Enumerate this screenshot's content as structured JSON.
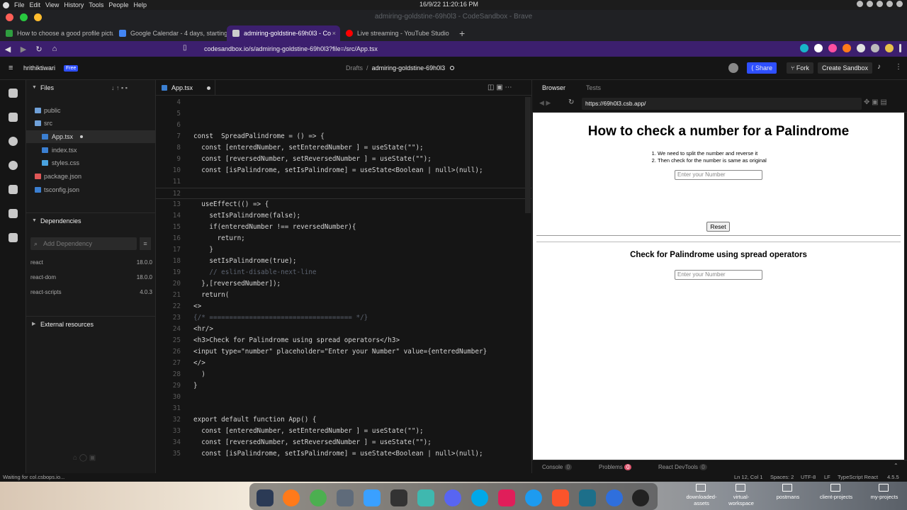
{
  "os": {
    "menu": [
      "File",
      "Edit",
      "View",
      "History",
      "Tools",
      "People",
      "Help"
    ],
    "clock": "16/9/22 11:20:16 PM",
    "window_title": "admiring-goldstine-69h0l3 - CodeSandbox - Brave"
  },
  "tabs": [
    {
      "label": "How to choose a good profile pictur",
      "fav": "#2e9e3f",
      "active": false
    },
    {
      "label": "Google Calendar - 4 days, starting 1",
      "fav": "#4285f4",
      "active": false
    },
    {
      "label": "admiring-goldstine-69h0l3 - Co",
      "fav": "#cccccc",
      "active": true
    },
    {
      "label": "Live streaming - YouTube Studio",
      "fav": "#ff0000",
      "active": false
    }
  ],
  "address": {
    "url": "codesandbox.io/s/admiring-goldstine-69h0l3?file=/src/App.tsx"
  },
  "header": {
    "user": "hrithiktiwari",
    "badge": "Free",
    "crumb_root": "Drafts",
    "crumb_sep": "/",
    "sandbox_name": "admiring-goldstine-69h0l3",
    "share": "Share",
    "fork": "Fork",
    "create": "Create Sandbox"
  },
  "sidebar": {
    "files_title": "Files",
    "tree": [
      {
        "label": "public",
        "kind": "folder",
        "indent": 1
      },
      {
        "label": "src",
        "kind": "folder-open",
        "indent": 1
      },
      {
        "label": "App.tsx",
        "kind": "ts",
        "indent": 2,
        "selected": true
      },
      {
        "label": "index.tsx",
        "kind": "ts",
        "indent": 2
      },
      {
        "label": "styles.css",
        "kind": "css",
        "indent": 2
      },
      {
        "label": "package.json",
        "kind": "json",
        "indent": 1
      },
      {
        "label": "tsconfig.json",
        "kind": "ts",
        "indent": 1
      }
    ],
    "deps_title": "Dependencies",
    "deps_placeholder": "Add Dependency",
    "deps": [
      {
        "name": "react",
        "version": "18.0.0"
      },
      {
        "name": "react-dom",
        "version": "18.0.0"
      },
      {
        "name": "react-scripts",
        "version": "4.0.3"
      }
    ],
    "external_title": "External resources"
  },
  "editor": {
    "tab": "App.tsx",
    "lines": [
      {
        "n": "4",
        "t": ""
      },
      {
        "n": "5",
        "t": ""
      },
      {
        "n": "6",
        "t": ""
      },
      {
        "n": "7",
        "t": "const  SpreadPalindrome = () => {"
      },
      {
        "n": "8",
        "t": "  const [enteredNumber, setEnteredNumber ] = useState(\"\");"
      },
      {
        "n": "9",
        "t": "  const [reversedNumber, setReversedNumber ] = useState(\"\");"
      },
      {
        "n": "10",
        "t": "  const [isPalindrome, setIsPalindrome] = useState<Boolean | null>(null);"
      },
      {
        "n": "11",
        "t": ""
      },
      {
        "n": "12",
        "t": ""
      },
      {
        "n": "13",
        "t": "  useEffect(() => {"
      },
      {
        "n": "14",
        "t": "    setIsPalindrome(false);"
      },
      {
        "n": "15",
        "t": "    if(enteredNumber !== reversedNumber){"
      },
      {
        "n": "16",
        "t": "      return;"
      },
      {
        "n": "17",
        "t": "    }"
      },
      {
        "n": "18",
        "t": "    setIsPalindrome(true);"
      },
      {
        "n": "19",
        "t": "    // eslint-disable-next-line"
      },
      {
        "n": "20",
        "t": "  },[reversedNumber]);"
      },
      {
        "n": "21",
        "t": "  return("
      },
      {
        "n": "22",
        "t": "<>"
      },
      {
        "n": "23",
        "t": "{/* ==================================== */}"
      },
      {
        "n": "24",
        "t": "<hr/>"
      },
      {
        "n": "25",
        "t": "<h3>Check for Palindrome using spread operators</h3>"
      },
      {
        "n": "26",
        "t": "<input type=\"number\" placeholder=\"Enter your Number\" value={enteredNumber}"
      },
      {
        "n": "27",
        "t": "</>"
      },
      {
        "n": "28",
        "t": "  )"
      },
      {
        "n": "29",
        "t": "}"
      },
      {
        "n": "30",
        "t": ""
      },
      {
        "n": "31",
        "t": ""
      },
      {
        "n": "32",
        "t": "export default function App() {"
      },
      {
        "n": "33",
        "t": "  const [enteredNumber, setEnteredNumber ] = useState(\"\");"
      },
      {
        "n": "34",
        "t": "  const [reversedNumber, setReversedNumber ] = useState(\"\");"
      },
      {
        "n": "35",
        "t": "  const [isPalindrome, setIsPalindrome] = useState<Boolean | null>(null);"
      }
    ]
  },
  "preview": {
    "tab_browser": "Browser",
    "tab_tests": "Tests",
    "url": "https://69h0l3.csb.app/",
    "heading": "How to check a number for a Palindrome",
    "steps": [
      "We need to split the number and reverse it",
      "Then check for the number is same as original"
    ],
    "input_placeholder": "Enter your Number",
    "reset": "Reset",
    "heading2": "Check for Palindrome using spread operators",
    "input2_placeholder": "Enter your Number",
    "console": "Console",
    "console_count": "0",
    "problems": "Problems",
    "problems_count": "0",
    "devtools": "React DevTools",
    "devtools_count": "0"
  },
  "status": {
    "left": "Waiting for col.csbops.io...",
    "position": "Ln 12, Col 1",
    "spaces": "Spaces: 2",
    "encoding": "UTF-8",
    "eol": "LF",
    "language": "TypeScript React",
    "version": "4.5.5"
  },
  "dock": {
    "folders": [
      "downloaded-assets",
      "virtual-workspace",
      "postmans",
      "client-projects",
      "my-projects"
    ]
  },
  "colors": {
    "accent": "#3c1f6e",
    "share_btn": "#2e4fff"
  }
}
